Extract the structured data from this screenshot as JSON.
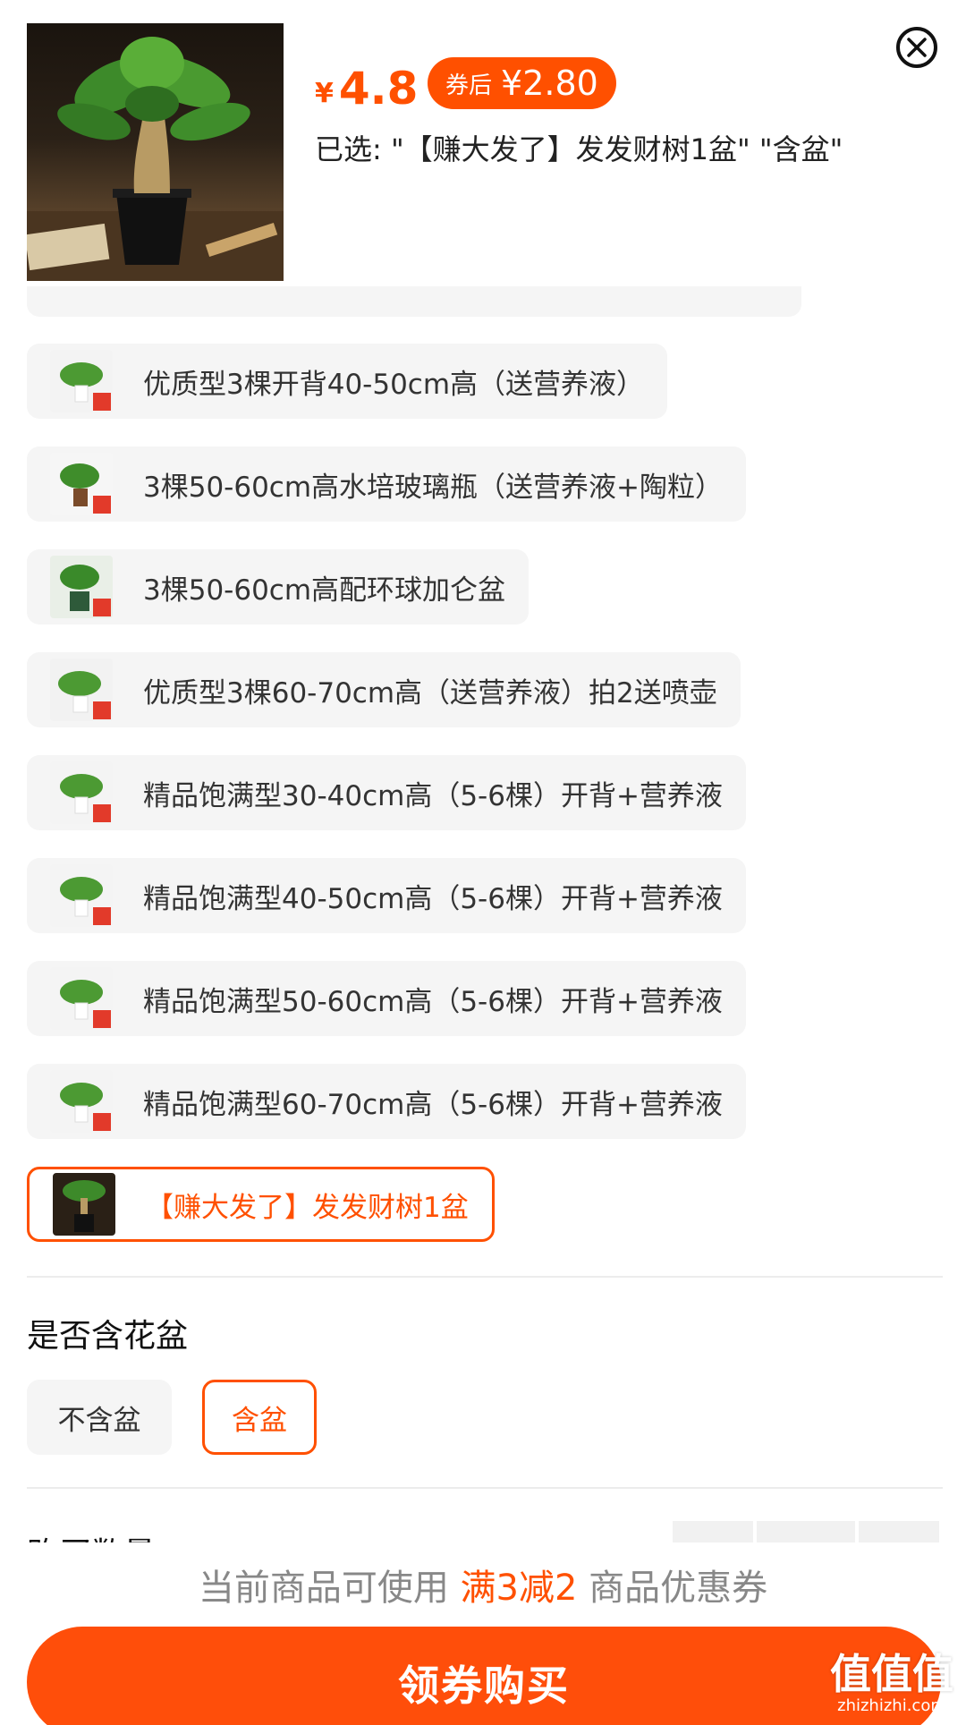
{
  "header": {
    "price_symbol": "¥",
    "price": "4.8",
    "coupon_tag": "券后",
    "coupon_price": "¥2.80",
    "selected_text": "已选: \"【赚大发了】发发财树1盆\" \"含盆\"",
    "close_icon": "close-circle-icon"
  },
  "options": {
    "items": [
      {
        "label": "优质型3棵开背40-50cm高（送营养液）"
      },
      {
        "label": "3棵50-60cm高水培玻璃瓶（送营养液+陶粒）"
      },
      {
        "label": "3棵50-60cm高配环球加仑盆"
      },
      {
        "label": "优质型3棵60-70cm高（送营养液）拍2送喷壶"
      },
      {
        "label": "精品饱满型30-40cm高（5-6棵）开背+营养液"
      },
      {
        "label": "精品饱满型40-50cm高（5-6棵）开背+营养液"
      },
      {
        "label": "精品饱满型50-60cm高（5-6棵）开背+营养液"
      },
      {
        "label": "精品饱满型60-70cm高（5-6棵）开背+营养液"
      },
      {
        "label": "【赚大发了】发发财树1盆",
        "selected": true
      }
    ]
  },
  "pot_section": {
    "title": "是否含花盆",
    "options": [
      {
        "label": "不含盆",
        "selected": false
      },
      {
        "label": "含盆",
        "selected": true
      }
    ]
  },
  "quantity_section": {
    "title_partial": "购买数量"
  },
  "coupon_tip": {
    "prefix": "当前商品可使用 ",
    "highlight": "满3减2",
    "suffix": " 商品优惠券"
  },
  "buy_button": {
    "label": "领券购买"
  },
  "watermark": {
    "logo": "值值值",
    "url": "zhizhizhi.com"
  },
  "colors": {
    "accent": "#ff5000",
    "chip_bg": "#f5f5f5",
    "text_primary": "#222222",
    "text_muted": "#888888"
  }
}
